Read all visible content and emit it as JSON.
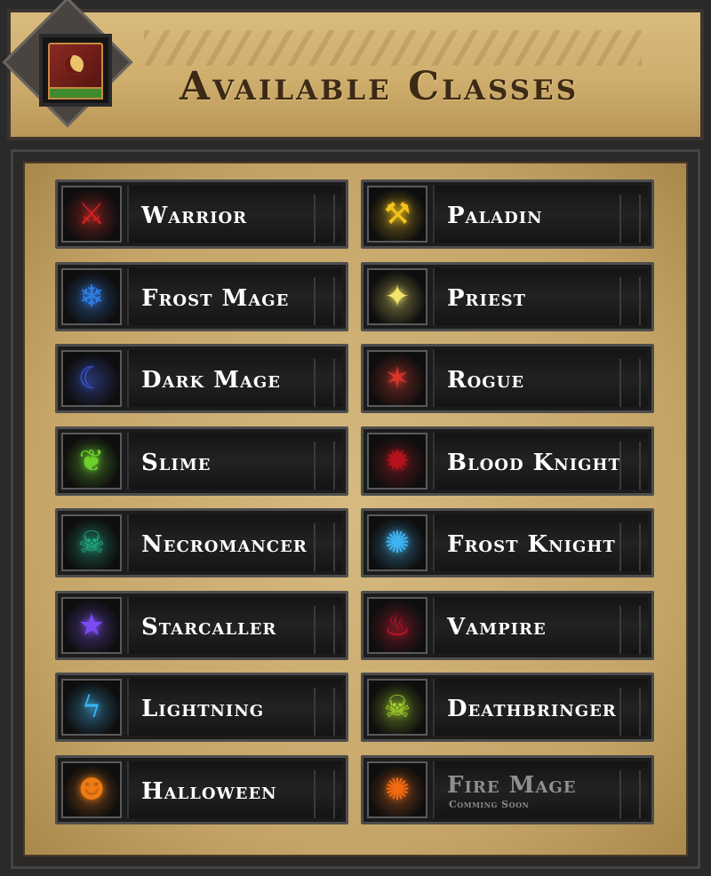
{
  "header": {
    "title": "Available Classes",
    "icon": "spellbook-icon"
  },
  "classes": [
    {
      "name": "Warrior",
      "icon": "crossed-axes-icon",
      "color": "#d42222",
      "glyph": "⚔",
      "subtitle": ""
    },
    {
      "name": "Paladin",
      "icon": "holy-hammer-icon",
      "color": "#f2c21a",
      "glyph": "⚒",
      "subtitle": ""
    },
    {
      "name": "Frost Mage",
      "icon": "ice-crystal-icon",
      "color": "#2f7ee8",
      "glyph": "❄",
      "subtitle": ""
    },
    {
      "name": "Priest",
      "icon": "holy-light-icon",
      "color": "#f2e56b",
      "glyph": "✦",
      "subtitle": ""
    },
    {
      "name": "Dark Mage",
      "icon": "dark-vortex-icon",
      "color": "#3a56d9",
      "glyph": "☾",
      "subtitle": ""
    },
    {
      "name": "Rogue",
      "icon": "dagger-slash-icon",
      "color": "#d9352a",
      "glyph": "✶",
      "subtitle": ""
    },
    {
      "name": "Slime",
      "icon": "slime-splash-icon",
      "color": "#6cd12a",
      "glyph": "❦",
      "subtitle": ""
    },
    {
      "name": "Blood Knight",
      "icon": "blood-splatter-icon",
      "color": "#b3121c",
      "glyph": "✹",
      "subtitle": ""
    },
    {
      "name": "Necromancer",
      "icon": "skull-portal-icon",
      "color": "#1fae86",
      "glyph": "☠",
      "subtitle": ""
    },
    {
      "name": "Frost Knight",
      "icon": "frost-burst-icon",
      "color": "#3fb3f2",
      "glyph": "✺",
      "subtitle": ""
    },
    {
      "name": "Starcaller",
      "icon": "falling-star-icon",
      "color": "#7a4cf2",
      "glyph": "★",
      "subtitle": ""
    },
    {
      "name": "Vampire",
      "icon": "vampire-bite-icon",
      "color": "#c8142a",
      "glyph": "♨",
      "subtitle": ""
    },
    {
      "name": "Lightning",
      "icon": "lightning-bolt-icon",
      "color": "#3ab6f5",
      "glyph": "ϟ",
      "subtitle": ""
    },
    {
      "name": "Deathbringer",
      "icon": "green-skull-icon",
      "color": "#a8d92a",
      "glyph": "☠",
      "subtitle": ""
    },
    {
      "name": "Halloween",
      "icon": "jack-o-lantern-icon",
      "color": "#f07a14",
      "glyph": "☻",
      "subtitle": ""
    },
    {
      "name": "Fire Mage",
      "icon": "fire-ring-icon",
      "color": "#f26a12",
      "glyph": "✺",
      "subtitle": "Comming Soon",
      "disabled": true
    }
  ]
}
